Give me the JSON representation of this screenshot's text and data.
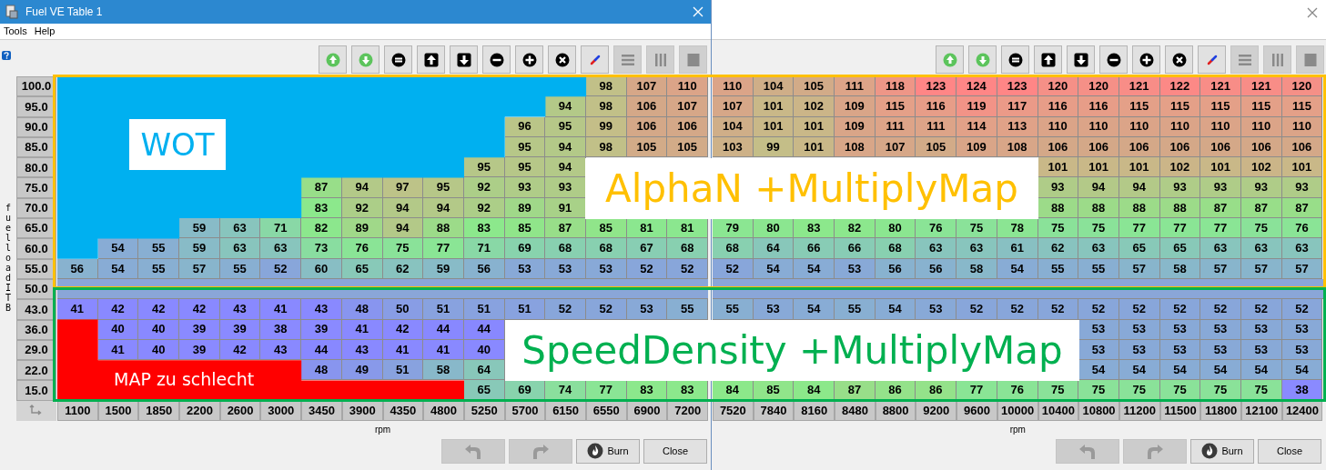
{
  "windows": [
    {
      "title": "Fuel VE Table 1",
      "menu": [
        "Tools",
        "Help"
      ],
      "toolbar": [
        {
          "kind": "up_green",
          "disabled": false
        },
        {
          "kind": "down_green",
          "disabled": false
        },
        {
          "kind": "equals",
          "disabled": false
        },
        {
          "kind": "arrow_up",
          "disabled": false
        },
        {
          "kind": "arrow_down",
          "disabled": false
        },
        {
          "kind": "minus",
          "disabled": false
        },
        {
          "kind": "plus",
          "disabled": false
        },
        {
          "kind": "cancel",
          "disabled": false
        },
        {
          "kind": "pen",
          "disabled": false
        },
        {
          "kind": "rows",
          "disabled": true
        },
        {
          "kind": "columns",
          "disabled": true
        },
        {
          "kind": "block",
          "disabled": true
        }
      ],
      "y_axis_title": "fuelload ITB",
      "rows": [
        {
          "kind": "data",
          "label": "100.0",
          "cells": [
            null,
            null,
            null,
            null,
            null,
            null,
            null,
            null,
            null,
            null,
            null,
            null,
            null,
            "98",
            "107",
            "110"
          ]
        },
        {
          "kind": "data",
          "label": "95.0",
          "cells": [
            null,
            null,
            null,
            null,
            null,
            null,
            null,
            null,
            null,
            null,
            null,
            null,
            "94",
            "98",
            "106",
            "107"
          ]
        },
        {
          "kind": "data",
          "label": "90.0",
          "cells": [
            null,
            null,
            null,
            null,
            null,
            null,
            null,
            null,
            null,
            null,
            null,
            "96",
            "95",
            "99",
            "106",
            "106"
          ]
        },
        {
          "kind": "data",
          "label": "85.0",
          "cells": [
            null,
            null,
            null,
            null,
            null,
            null,
            null,
            null,
            null,
            null,
            null,
            "95",
            "94",
            "98",
            "105",
            "105"
          ]
        },
        {
          "kind": "data",
          "label": "80.0",
          "cells": [
            null,
            null,
            null,
            null,
            null,
            null,
            null,
            null,
            null,
            null,
            "95",
            "95",
            "94",
            null,
            null,
            null
          ]
        },
        {
          "kind": "data",
          "label": "75.0",
          "cells": [
            null,
            null,
            null,
            null,
            null,
            null,
            "87",
            "94",
            "97",
            "95",
            "92",
            "93",
            "93",
            null,
            null,
            null
          ]
        },
        {
          "kind": "data",
          "label": "70.0",
          "cells": [
            null,
            null,
            null,
            null,
            null,
            null,
            "83",
            "92",
            "94",
            "94",
            "92",
            "89",
            "91",
            null,
            null,
            null
          ]
        },
        {
          "kind": "data",
          "label": "65.0",
          "cells": [
            null,
            null,
            null,
            "59",
            "63",
            "71",
            "82",
            "89",
            "94",
            "88",
            "83",
            "85",
            "87",
            "85",
            "81",
            "81"
          ]
        },
        {
          "kind": "data",
          "label": "60.0",
          "cells": [
            null,
            "54",
            "55",
            "59",
            "63",
            "63",
            "73",
            "76",
            "75",
            "77",
            "71",
            "69",
            "68",
            "68",
            "67",
            "68"
          ]
        },
        {
          "kind": "data",
          "label": "55.0",
          "cells": [
            "56",
            "54",
            "55",
            "57",
            "55",
            "52",
            "60",
            "65",
            "62",
            "59",
            "56",
            "53",
            "53",
            "53",
            "52",
            "52"
          ]
        },
        {
          "kind": "obscured",
          "label": "50.0"
        },
        {
          "kind": "data",
          "label": "43.0",
          "cells": [
            "41",
            "42",
            "42",
            "42",
            "43",
            "41",
            "43",
            "48",
            "50",
            "51",
            "51",
            "51",
            "52",
            "52",
            "53",
            "55"
          ]
        },
        {
          "kind": "data",
          "label": "36.0",
          "cells": [
            null,
            "40",
            "40",
            "39",
            "39",
            "38",
            "39",
            "41",
            "42",
            "44",
            "44",
            null,
            null,
            null,
            null,
            null
          ]
        },
        {
          "kind": "data",
          "label": "29.0",
          "cells": [
            null,
            "41",
            "40",
            "39",
            "42",
            "43",
            "44",
            "43",
            "41",
            "41",
            "40",
            null,
            null,
            null,
            null,
            null
          ]
        },
        {
          "kind": "data",
          "label": "22.0",
          "cells": [
            null,
            null,
            null,
            null,
            null,
            null,
            "48",
            "49",
            "51",
            "58",
            "64",
            null,
            null,
            null,
            null,
            null
          ]
        },
        {
          "kind": "data",
          "label": "15.0",
          "cells": [
            null,
            null,
            null,
            null,
            null,
            null,
            null,
            null,
            null,
            null,
            "65",
            "69",
            "74",
            "77",
            "83",
            "83"
          ]
        }
      ],
      "x_axis": [
        "1100",
        "1500",
        "1850",
        "2200",
        "2600",
        "3000",
        "3450",
        "3900",
        "4350",
        "4800",
        "5250",
        "5700",
        "6150",
        "6550",
        "6900",
        "7200"
      ],
      "x_axis_title": "rpm",
      "buttons": [
        {
          "kind": "undo",
          "disabled": true
        },
        {
          "kind": "redo",
          "disabled": true
        },
        {
          "kind": "burn",
          "label": "Burn",
          "disabled": false
        },
        {
          "kind": "close",
          "label": "Close",
          "disabled": false
        }
      ]
    },
    {
      "toolbar": [
        {
          "kind": "up_green",
          "disabled": false
        },
        {
          "kind": "down_green",
          "disabled": false
        },
        {
          "kind": "equals",
          "disabled": false
        },
        {
          "kind": "arrow_up",
          "disabled": false
        },
        {
          "kind": "arrow_down",
          "disabled": false
        },
        {
          "kind": "minus",
          "disabled": false
        },
        {
          "kind": "plus",
          "disabled": false
        },
        {
          "kind": "cancel",
          "disabled": false
        },
        {
          "kind": "pen",
          "disabled": false
        },
        {
          "kind": "rows",
          "disabled": true
        },
        {
          "kind": "columns",
          "disabled": true
        },
        {
          "kind": "block",
          "disabled": true
        }
      ],
      "rows": [
        {
          "kind": "data",
          "cells": [
            "110",
            "104",
            "105",
            "111",
            "118",
            "123",
            "124",
            "123",
            "120",
            "120",
            "121",
            "122",
            "121",
            "121",
            "120"
          ]
        },
        {
          "kind": "data",
          "cells": [
            "107",
            "101",
            "102",
            "109",
            "115",
            "116",
            "119",
            "117",
            "116",
            "116",
            "115",
            "115",
            "115",
            "115",
            "115"
          ]
        },
        {
          "kind": "data",
          "cells": [
            "104",
            "101",
            "101",
            "109",
            "111",
            "111",
            "114",
            "113",
            "110",
            "110",
            "110",
            "110",
            "110",
            "110",
            "110"
          ]
        },
        {
          "kind": "data",
          "cells": [
            "103",
            "99",
            "101",
            "108",
            "107",
            "105",
            "109",
            "108",
            "106",
            "106",
            "106",
            "106",
            "106",
            "106",
            "106"
          ]
        },
        {
          "kind": "data",
          "cells": [
            null,
            null,
            null,
            null,
            null,
            null,
            null,
            null,
            "101",
            "101",
            "101",
            "102",
            "101",
            "102",
            "101"
          ]
        },
        {
          "kind": "data",
          "cells": [
            null,
            null,
            null,
            null,
            null,
            null,
            null,
            null,
            "93",
            "94",
            "94",
            "93",
            "93",
            "93",
            "93"
          ]
        },
        {
          "kind": "data",
          "cells": [
            null,
            null,
            null,
            null,
            null,
            null,
            null,
            null,
            "88",
            "88",
            "88",
            "88",
            "87",
            "87",
            "87"
          ]
        },
        {
          "kind": "data",
          "cells": [
            "79",
            "80",
            "83",
            "82",
            "80",
            "76",
            "75",
            "78",
            "75",
            "75",
            "77",
            "77",
            "77",
            "75",
            "76"
          ]
        },
        {
          "kind": "data",
          "cells": [
            "68",
            "64",
            "66",
            "66",
            "68",
            "63",
            "63",
            "61",
            "62",
            "63",
            "65",
            "65",
            "63",
            "63",
            "63"
          ]
        },
        {
          "kind": "data",
          "cells": [
            "52",
            "54",
            "54",
            "53",
            "56",
            "56",
            "58",
            "54",
            "55",
            "55",
            "57",
            "58",
            "57",
            "57",
            "57"
          ]
        },
        {
          "kind": "obscured"
        },
        {
          "kind": "data",
          "cells": [
            "55",
            "53",
            "54",
            "55",
            "54",
            "53",
            "52",
            "52",
            "52",
            "52",
            "52",
            "52",
            "52",
            "52",
            "52"
          ]
        },
        {
          "kind": "data",
          "cells": [
            null,
            null,
            null,
            null,
            null,
            null,
            null,
            null,
            null,
            "53",
            "53",
            "53",
            "53",
            "53",
            "53"
          ]
        },
        {
          "kind": "data",
          "cells": [
            null,
            null,
            null,
            null,
            null,
            null,
            null,
            null,
            null,
            "53",
            "53",
            "53",
            "53",
            "53",
            "53"
          ]
        },
        {
          "kind": "data",
          "cells": [
            null,
            null,
            null,
            null,
            null,
            null,
            null,
            null,
            null,
            "54",
            "54",
            "54",
            "54",
            "54",
            "54"
          ]
        },
        {
          "kind": "data",
          "cells": [
            "84",
            "85",
            "84",
            "87",
            "86",
            "86",
            "77",
            "76",
            "75",
            "75",
            "75",
            "75",
            "75",
            "75",
            "38"
          ]
        }
      ],
      "x_axis": [
        "7520",
        "7840",
        "8160",
        "8480",
        "8800",
        "9200",
        "9600",
        "10000",
        "10400",
        "10800",
        "11200",
        "11500",
        "11800",
        "12100",
        "12400"
      ],
      "x_axis_title": "rpm",
      "buttons": [
        {
          "kind": "undo",
          "disabled": true
        },
        {
          "kind": "redo",
          "disabled": true
        },
        {
          "kind": "burn",
          "label": "Burn",
          "disabled": false
        },
        {
          "kind": "close",
          "label": "Close",
          "disabled": false
        }
      ]
    }
  ],
  "annotations": [
    {
      "kind": "region",
      "color": "#00b0f0"
    },
    {
      "kind": "region",
      "color": "#ff0000"
    },
    {
      "kind": "frame",
      "color": "#ffc000"
    },
    {
      "kind": "frame",
      "color": "#00b050"
    },
    {
      "kind": "label",
      "text": "WOT",
      "color": "#00b0f0"
    },
    {
      "kind": "label",
      "text": "AlphaN +MultiplyMap",
      "color": "#ffc000"
    },
    {
      "kind": "label",
      "text": "SpeedDensity +MultiplyMap",
      "color": "#00b050"
    },
    {
      "kind": "caption",
      "text": "MAP zu schlecht"
    }
  ]
}
